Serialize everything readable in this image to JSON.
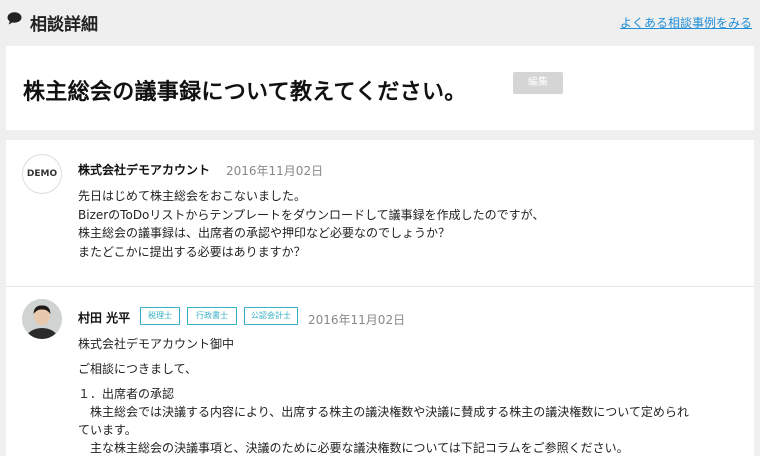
{
  "header": {
    "title": "相談詳細",
    "link": "よくある相談事例をみる"
  },
  "question": {
    "title": "株主総会の議事録について教えてください。",
    "edit_label": "編集"
  },
  "posts": [
    {
      "avatar_text": "DEMO",
      "author": "株式会社デモアカウント",
      "date": "2016年11月02日",
      "lines": [
        "先日はじめて株主総会をおこないました。",
        "BizerのToDoリストからテンプレートをダウンロードして議事録を作成したのですが、",
        "株主総会の議事録は、出席者の承認や押印など必要なのでしょうか？",
        "またどこかに提出する必要はありますか？"
      ]
    },
    {
      "author": "村田 光平",
      "badges": [
        "税理士",
        "行政書士",
        "公認会計士"
      ],
      "date": "2016年11月02日",
      "lines": [
        "株式会社デモアカウント御中",
        "ご相談につきまして、",
        "１．出席者の承認",
        "　株主総会では決議する内容により、出席する株主の議決権数や決議に賛成する株主の議決権数について定められ",
        "ています。",
        "　主な株主総会の決議事項と、決議のために必要な議決権数については下記コラムをご参照ください。"
      ]
    }
  ],
  "colors": {
    "background": "#efefef",
    "link": "#1e8ed8",
    "badge": "#35b0c4",
    "edit_button": "#d5d5d5"
  }
}
